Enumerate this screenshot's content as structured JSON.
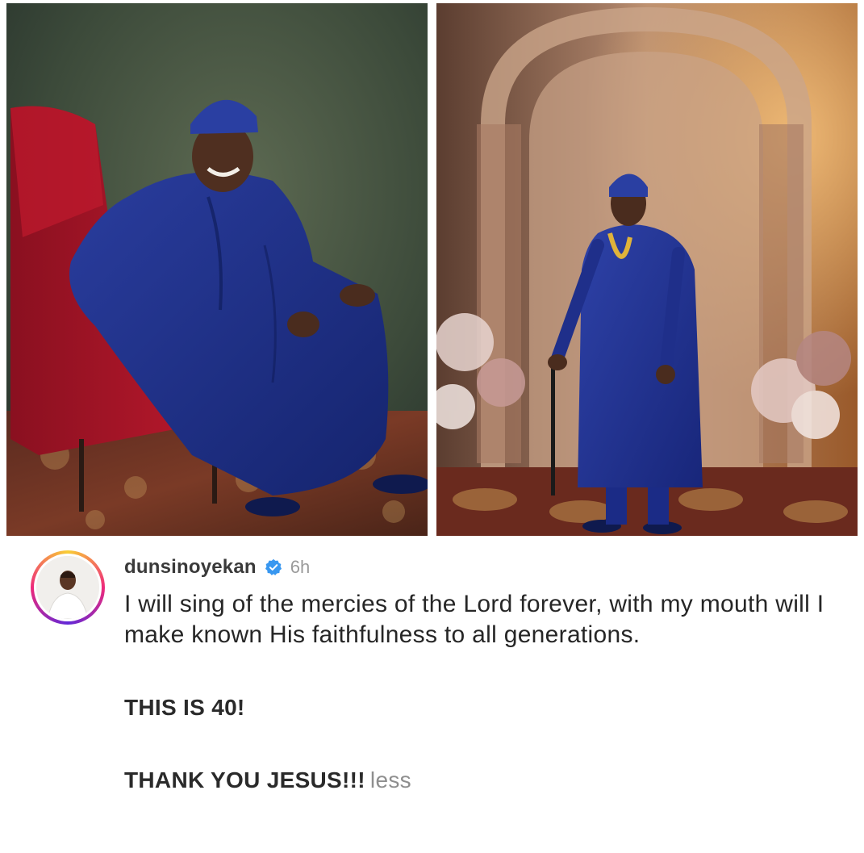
{
  "post": {
    "username": "dunsinoyekan",
    "timestamp": "6h",
    "caption": {
      "verse": "I will sing of the mercies of the Lord forever, with my mouth will I make known His faithfulness to all generations.",
      "line_two": "THIS IS 40!",
      "line_three": "THANK YOU JESUS!!!",
      "less_label": "less"
    }
  },
  "icons": {
    "verified": "verified-badge-icon",
    "avatar": "avatar"
  },
  "colors": {
    "verified": "#3897f0",
    "username": "#3a3a3a",
    "timestamp": "#9a9a9a",
    "less_link": "#8e8e8e",
    "story_ring_start": "#f9ce34",
    "story_ring_mid": "#ee2a7b",
    "story_ring_end": "#6228d7"
  }
}
